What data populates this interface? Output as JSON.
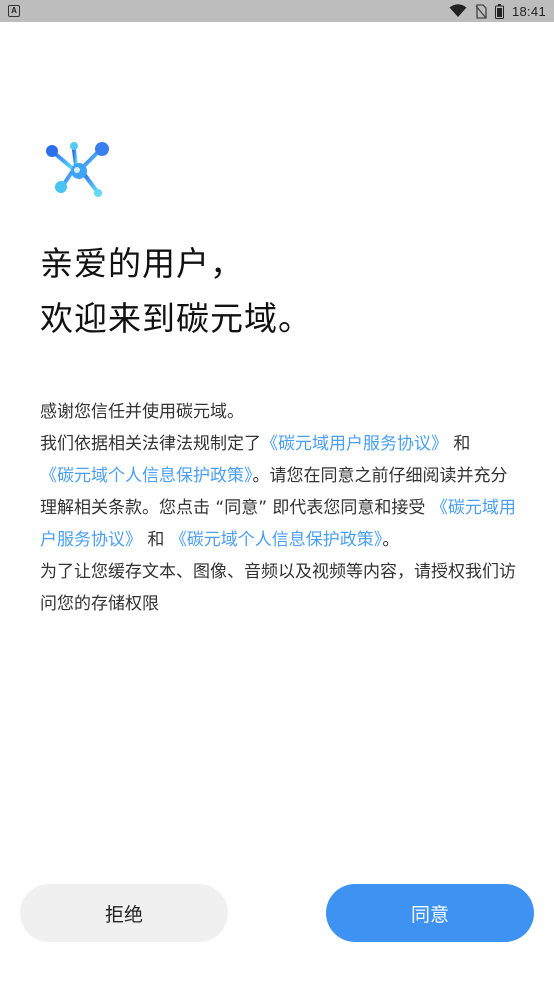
{
  "status_bar": {
    "left_icon": "A",
    "time": "18:41",
    "icons": [
      "wifi-icon",
      "no-sim-icon",
      "battery-icon"
    ]
  },
  "app": {
    "logo_icon": "molecule-logo-icon"
  },
  "greeting": {
    "line1": "亲爱的用户，",
    "line2": "欢迎来到碳元域。"
  },
  "body": {
    "intro": "感谢您信任并使用碳元域。",
    "p2_prefix": "我们依据相关法律法规制定了",
    "user_agreement": "《碳元域用户服务协议》",
    "and1": "和",
    "privacy_policy": "《碳元域个人信息保护政策》",
    "p2_middle": "。请您在同意之前仔细阅读并充分理解相关条款。您点击 “同意” 即代表您同意和接受",
    "user_agreement_2": "《碳元域用户服务协议》",
    "and2": "和",
    "privacy_policy_2": "《碳元域个人信息保护政策》",
    "p2_end": "。",
    "p3": "为了让您缓存文本、图像、音频以及视频等内容，请授权我们访问您的存储权限"
  },
  "buttons": {
    "reject": "拒绝",
    "agree": "同意"
  },
  "colors": {
    "link": "#4a9ff5",
    "primary_button": "#3e93f2",
    "secondary_button": "#f0f0f0",
    "status_bar": "#bdbdbd"
  }
}
